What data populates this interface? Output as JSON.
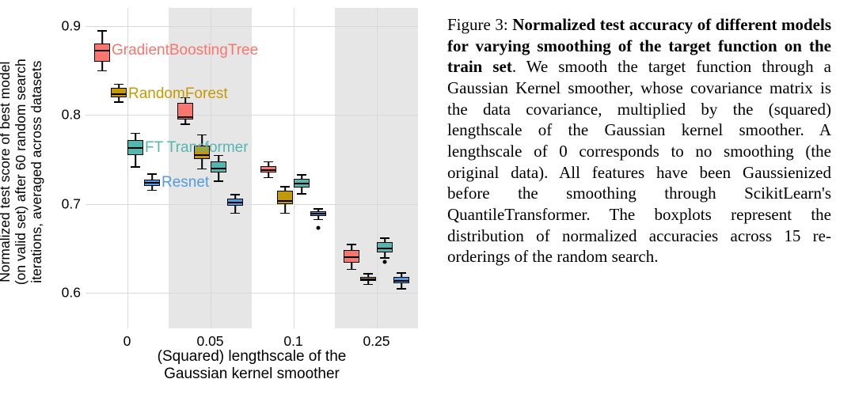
{
  "caption": {
    "label": "Figure 3: ",
    "bold": "Normalized test accuracy of different models for varying smoothing of the target function on the train set",
    "body_after_bold": ". We smooth the target function through a Gaussian Kernel smoother, whose covariance matrix is the data covariance, multiplied by the (squared) lengthscale of the Gaussian kernel smoother. A lengthscale of 0 corresponds to no smoothing (the original data). All features have been Gaussienized before the smoothing through ScikitLearn's QuantileTransformer. The boxplots represent the distribution of normalized accuracies across 15 re-orderings of the random search."
  },
  "chart": {
    "ylabel": "Normalized test score of best model\n(on valid set) after 60 random search\niterations, averaged across datasets",
    "xlabel": "(Squared) lengthscale of the\nGaussian kernel smoother",
    "y_ticks": [
      "0.6",
      "0.7",
      "0.8",
      "0.9"
    ],
    "x_ticks": [
      "0",
      "0.05",
      "0.1",
      "0.25"
    ],
    "series_labels": {
      "gbt": "GradientBoostingTree",
      "rf": "RandomForest",
      "ftt": "FT Transformer",
      "resnet": "Resnet"
    },
    "colors": {
      "gbt": "#F8766D",
      "rf": "#C49A00",
      "ftt": "#53B7B0",
      "resnet": "#4F9DE0"
    }
  },
  "chart_data": {
    "type": "boxplot",
    "title": "",
    "xlabel": "(Squared) lengthscale of the Gaussian kernel smoother",
    "ylabel": "Normalized test score of best model (on valid set) after 60 random search iterations, averaged across datasets",
    "categories": [
      0,
      0.05,
      0.1,
      0.25
    ],
    "ylim": [
      0.56,
      0.92
    ],
    "series": [
      {
        "name": "GradientBoostingTree",
        "color": "#F8766D",
        "boxes": [
          {
            "x": 0,
            "low": 0.85,
            "q1": 0.86,
            "median": 0.872,
            "q3": 0.88,
            "high": 0.895
          },
          {
            "x": 0.05,
            "low": 0.79,
            "q1": 0.795,
            "median": 0.797,
            "q3": 0.813,
            "high": 0.82
          },
          {
            "x": 0.1,
            "low": 0.73,
            "q1": 0.735,
            "median": 0.738,
            "q3": 0.742,
            "high": 0.748
          },
          {
            "x": 0.25,
            "low": 0.627,
            "q1": 0.634,
            "median": 0.64,
            "q3": 0.648,
            "high": 0.655
          }
        ]
      },
      {
        "name": "RandomForest",
        "color": "#C49A00",
        "boxes": [
          {
            "x": 0,
            "low": 0.815,
            "q1": 0.82,
            "median": 0.823,
            "q3": 0.83,
            "high": 0.835
          },
          {
            "x": 0.05,
            "low": 0.74,
            "q1": 0.75,
            "median": 0.755,
            "q3": 0.765,
            "high": 0.778
          },
          {
            "x": 0.1,
            "low": 0.69,
            "q1": 0.7,
            "median": 0.703,
            "q3": 0.715,
            "high": 0.72
          },
          {
            "x": 0.25,
            "low": 0.61,
            "q1": 0.613,
            "median": 0.615,
            "q3": 0.618,
            "high": 0.622
          }
        ]
      },
      {
        "name": "FT Transformer",
        "color": "#53B7B0",
        "boxes": [
          {
            "x": 0,
            "low": 0.742,
            "q1": 0.755,
            "median": 0.763,
            "q3": 0.772,
            "high": 0.78
          },
          {
            "x": 0.05,
            "low": 0.726,
            "q1": 0.735,
            "median": 0.74,
            "q3": 0.748,
            "high": 0.755
          },
          {
            "x": 0.1,
            "low": 0.712,
            "q1": 0.718,
            "median": 0.723,
            "q3": 0.728,
            "high": 0.733
          },
          {
            "x": 0.25,
            "low": 0.64,
            "q1": 0.645,
            "median": 0.65,
            "q3": 0.657,
            "high": 0.662,
            "outliers": [
              0.635
            ]
          }
        ]
      },
      {
        "name": "Resnet",
        "color": "#4F9DE0",
        "boxes": [
          {
            "x": 0,
            "low": 0.716,
            "q1": 0.72,
            "median": 0.724,
            "q3": 0.727,
            "high": 0.734
          },
          {
            "x": 0.05,
            "low": 0.69,
            "q1": 0.698,
            "median": 0.701,
            "q3": 0.706,
            "high": 0.711
          },
          {
            "x": 0.1,
            "low": 0.683,
            "q1": 0.686,
            "median": 0.689,
            "q3": 0.692,
            "high": 0.695,
            "outliers": [
              0.673
            ]
          },
          {
            "x": 0.25,
            "low": 0.605,
            "q1": 0.611,
            "median": 0.613,
            "q3": 0.618,
            "high": 0.623
          }
        ]
      }
    ]
  }
}
